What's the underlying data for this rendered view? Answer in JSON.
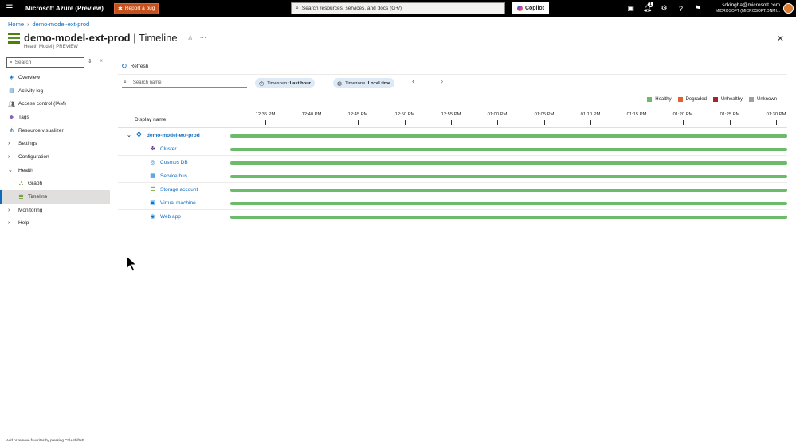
{
  "topbar": {
    "brand": "Microsoft Azure (Preview)",
    "report_bug": "Report a bug",
    "search_placeholder": "Search resources, services, and docs (G+/)",
    "copilot": "Copilot",
    "notification_count": "1",
    "account_email": "sckingha@microsoft.com",
    "account_tenant": "MICROSOFT (MICROSOFT.ONMI..."
  },
  "breadcrumb": {
    "home": "Home",
    "resource": "demo-model-ext-prod"
  },
  "header": {
    "resource_name": "demo-model-ext-prod",
    "separator": " | ",
    "page": "Timeline",
    "subtitle": "Health Model | PREVIEW"
  },
  "sidebar": {
    "search_placeholder": "Search",
    "items": [
      {
        "label": "Overview",
        "icon": "overview-icon"
      },
      {
        "label": "Activity log",
        "icon": "activity-log-icon"
      },
      {
        "label": "Access control (IAM)",
        "icon": "iam-icon"
      },
      {
        "label": "Tags",
        "icon": "tag-icon"
      },
      {
        "label": "Resource visualizer",
        "icon": "visualizer-icon"
      },
      {
        "label": "Settings",
        "icon": "chevron-right-icon"
      },
      {
        "label": "Configuration",
        "icon": "chevron-right-icon"
      },
      {
        "label": "Health",
        "icon": "chevron-down-icon"
      },
      {
        "label": "Graph",
        "icon": "graph-icon"
      },
      {
        "label": "Timeline",
        "icon": "timeline-icon"
      },
      {
        "label": "Monitoring",
        "icon": "chevron-right-icon"
      },
      {
        "label": "Help",
        "icon": "chevron-right-icon"
      }
    ],
    "footer_hint": "Add or remove favorites by pressing Ctrl+Shift+F"
  },
  "toolbar": {
    "refresh": "Refresh",
    "name_search_placeholder": "Search name",
    "timespan_label": "Timespan : ",
    "timespan_value": "Last hour",
    "timezone_label": "Timezone : ",
    "timezone_value": "Local time"
  },
  "legend": [
    {
      "label": "Healthy",
      "color": "#6cbb6a"
    },
    {
      "label": "Degraded",
      "color": "#e0612c"
    },
    {
      "label": "Unhealthy",
      "color": "#a4262c"
    },
    {
      "label": "Unknown",
      "color": "#a19f9d"
    }
  ],
  "timeline": {
    "column_title": "Display name",
    "ticks": [
      "12:35 PM",
      "12:40 PM",
      "12:45 PM",
      "12:50 PM",
      "12:55 PM",
      "01:00 PM",
      "01:05 PM",
      "01:10 PM",
      "01:15 PM",
      "01:20 PM",
      "01:25 PM",
      "01:30 PM"
    ],
    "rows": [
      {
        "name": "demo-model-ext-prod",
        "status": "Healthy",
        "level": "root",
        "icon": "health-model-icon"
      },
      {
        "name": "Cluster",
        "status": "Healthy",
        "level": "child",
        "icon": "cluster-icon"
      },
      {
        "name": "Cosmos DB",
        "status": "Healthy",
        "level": "child",
        "icon": "cosmos-db-icon"
      },
      {
        "name": "Service bus",
        "status": "Healthy",
        "level": "child",
        "icon": "service-bus-icon"
      },
      {
        "name": "Storage account",
        "status": "Healthy",
        "level": "child",
        "icon": "storage-account-icon"
      },
      {
        "name": "Virtual machine",
        "status": "Healthy",
        "level": "child",
        "icon": "virtual-machine-icon"
      },
      {
        "name": "Web app",
        "status": "Healthy",
        "level": "child",
        "icon": "web-app-icon"
      }
    ]
  }
}
